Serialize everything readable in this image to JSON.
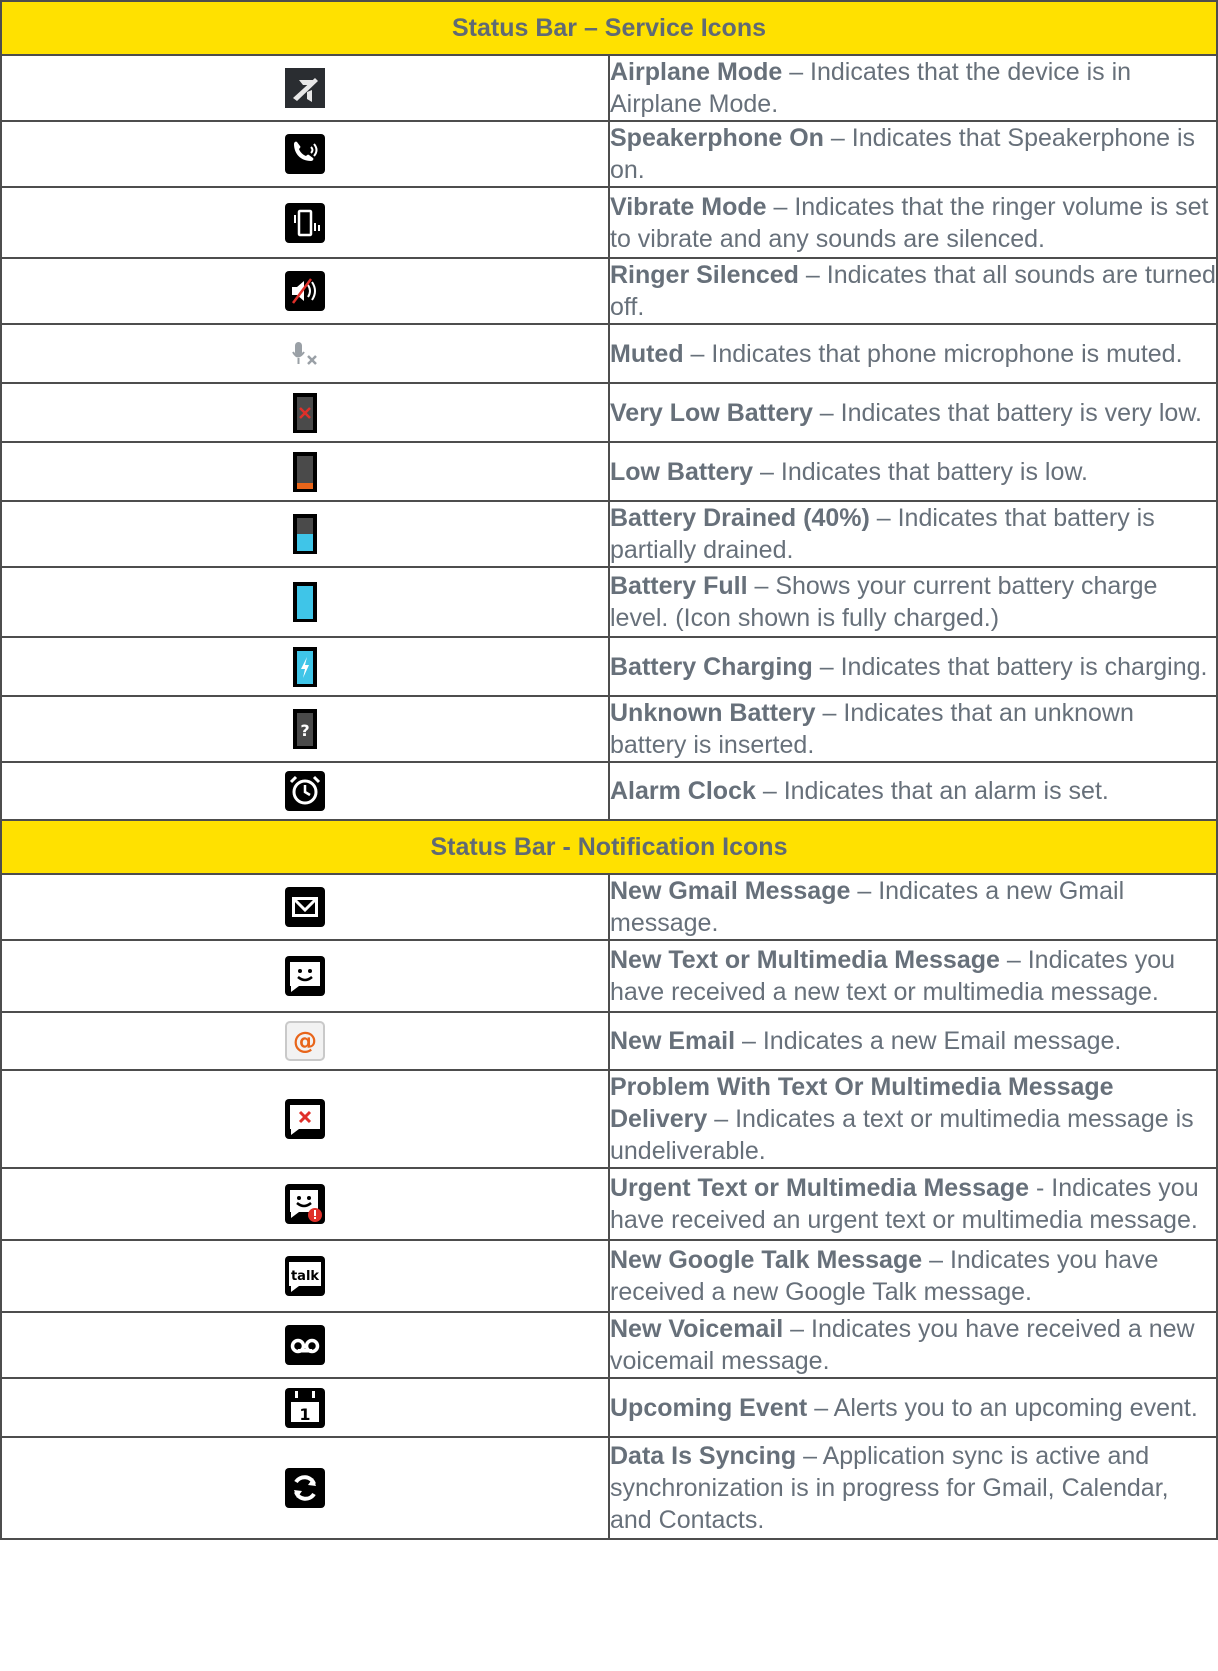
{
  "sections": [
    {
      "title": "Status Bar – Service Icons",
      "rows": [
        {
          "icon": "airplane-icon",
          "title": "Airplane Mode",
          "sep": " – ",
          "desc": "Indicates that the device is in Airplane Mode."
        },
        {
          "icon": "speakerphone-icon",
          "title": "Speakerphone On",
          "sep": " – ",
          "desc": "Indicates that Speakerphone is on."
        },
        {
          "icon": "vibrate-icon",
          "title": "Vibrate Mode",
          "sep": " – ",
          "desc": "Indicates that the ringer volume is set to vibrate and any sounds are silenced."
        },
        {
          "icon": "ringer-silenced-icon",
          "title": "Ringer Silenced",
          "sep": " – ",
          "desc": "Indicates that all sounds are turned off."
        },
        {
          "icon": "muted-microphone-icon",
          "title": "Muted",
          "sep": " – ",
          "desc": "Indicates that phone microphone is muted."
        },
        {
          "icon": "very-low-battery-icon",
          "title": "Very Low Battery",
          "sep": " – ",
          "desc": "Indicates that battery is very low."
        },
        {
          "icon": "low-battery-icon",
          "title": "Low Battery",
          "sep": " – ",
          "desc": "Indicates that battery is low."
        },
        {
          "icon": "battery-drained-icon",
          "title": "Battery Drained (40%)",
          "sep": " – ",
          "desc": "Indicates that battery is partially drained."
        },
        {
          "icon": "battery-full-icon",
          "title": "Battery Full",
          "sep": " – ",
          "desc": "Shows your current battery charge level. (Icon shown is fully charged.)"
        },
        {
          "icon": "battery-charging-icon",
          "title": "Battery Charging",
          "sep": " – ",
          "desc": "Indicates that battery is charging."
        },
        {
          "icon": "unknown-battery-icon",
          "title": "Unknown Battery",
          "sep": " – ",
          "desc": "Indicates that an unknown battery is inserted."
        },
        {
          "icon": "alarm-clock-icon",
          "title": "Alarm Clock",
          "sep": " – ",
          "desc": "Indicates that an alarm is set."
        }
      ]
    },
    {
      "title": "Status Bar - Notification Icons",
      "rows": [
        {
          "icon": "gmail-icon",
          "title": "New Gmail Message",
          "sep": " – ",
          "desc": "Indicates a new Gmail message."
        },
        {
          "icon": "new-message-icon",
          "title": "New Text or Multimedia Message",
          "sep": " – ",
          "desc": "Indicates you have received a new text or multimedia message."
        },
        {
          "icon": "email-icon",
          "title": "New Email",
          "sep": " – ",
          "desc": "Indicates a new Email message."
        },
        {
          "icon": "message-error-icon",
          "title": "Problem With Text Or Multimedia Message Delivery",
          "sep": " – ",
          "desc": "Indicates a text or multimedia message is undeliverable."
        },
        {
          "icon": "urgent-message-icon",
          "title": "Urgent Text or Multimedia Message",
          "sep": " - ",
          "desc": "Indicates you have received an urgent text or multimedia message."
        },
        {
          "icon": "google-talk-icon",
          "title": "New Google Talk Message",
          "sep": " – ",
          "desc": "Indicates you have received a new Google Talk message."
        },
        {
          "icon": "voicemail-icon",
          "title": "New Voicemail",
          "sep": " – ",
          "desc": "Indicates you have received a new voicemail message."
        },
        {
          "icon": "calendar-event-icon",
          "title": "Upcoming Event",
          "sep": " – ",
          "desc": "Alerts you to an upcoming event."
        },
        {
          "icon": "sync-icon",
          "title": "Data Is Syncing",
          "sep": " – ",
          "desc": "Application sync is active and synchronization is in progress for Gmail, Calendar, and Contacts."
        }
      ]
    }
  ],
  "icon_glyphs": {
    "talk_text": "talk",
    "calendar_day": "1",
    "unknown_mark": "?"
  },
  "colors": {
    "header_bg": "#ffe100",
    "text": "#67707a",
    "border": "#4d4d4d",
    "icon_cyan": "#3fc5e8",
    "icon_orange": "#e8651a",
    "icon_red": "#e0302a"
  }
}
